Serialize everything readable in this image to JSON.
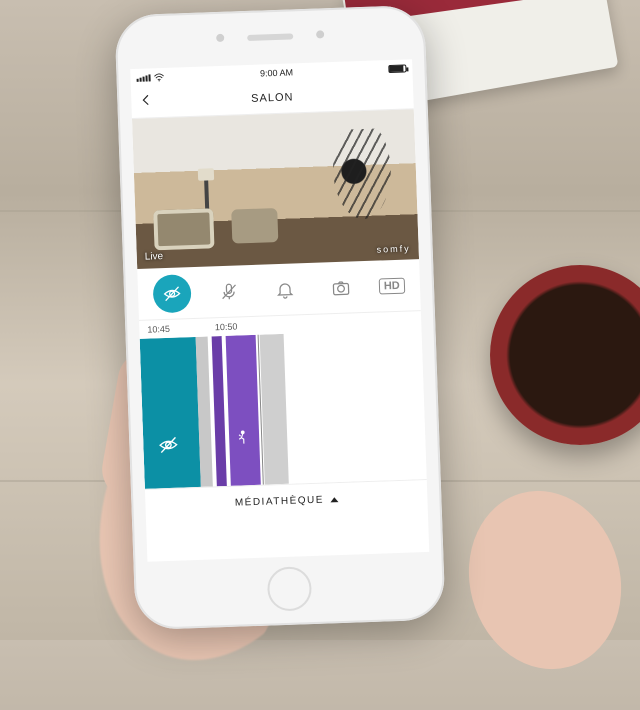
{
  "statusbar": {
    "time": "9:00 AM",
    "carrier": "●●●●●"
  },
  "navbar": {
    "title": "SALON"
  },
  "camera": {
    "live_label": "Live",
    "brand": "somfy"
  },
  "controls": {
    "privacy": "privacy",
    "mic": "mic-mute",
    "alert": "alert",
    "snapshot": "camera",
    "hd": "HD"
  },
  "timeline": {
    "marks": [
      "10:45",
      "10:50"
    ]
  },
  "footer": {
    "media": "MÉDIATHÈQUE"
  }
}
